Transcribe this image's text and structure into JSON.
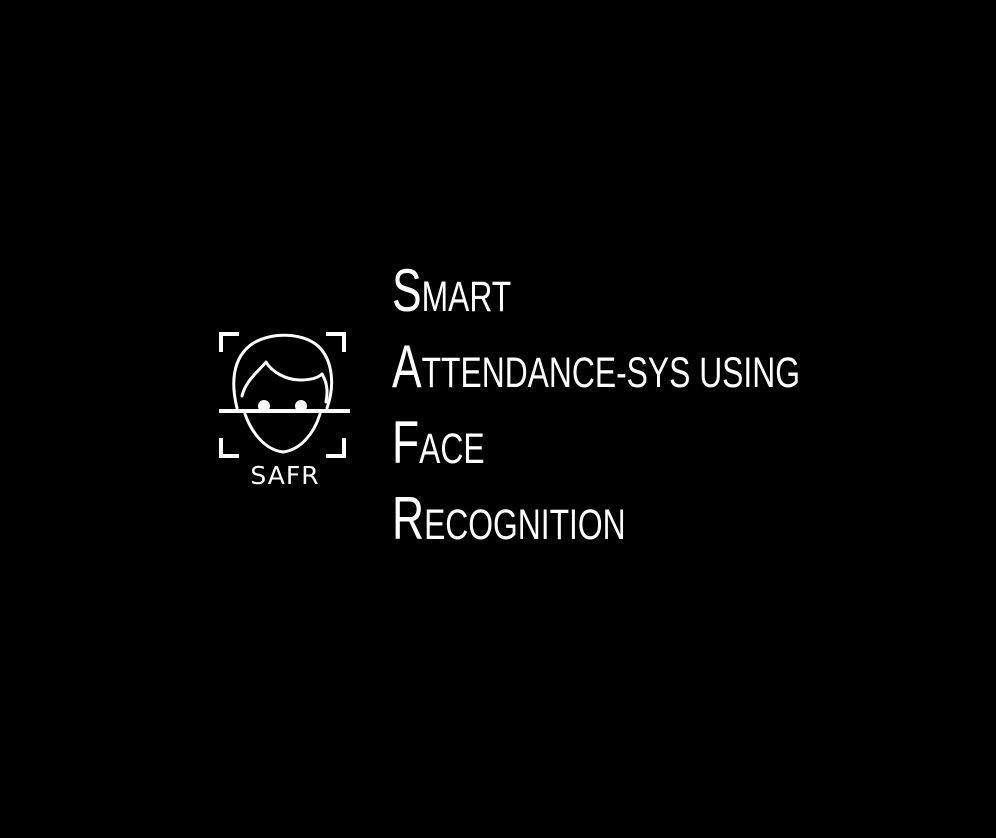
{
  "colors": {
    "background": "#000000",
    "foreground": "#ffffff"
  },
  "logo": {
    "icon": "face-scan-icon",
    "text": "SAFR"
  },
  "title": {
    "lines": [
      {
        "initial": "S",
        "rest": "mart"
      },
      {
        "initial": "A",
        "rest": "ttendance-sys using"
      },
      {
        "initial": "F",
        "rest": "ace"
      },
      {
        "initial": "R",
        "rest": "ecognition"
      }
    ]
  }
}
